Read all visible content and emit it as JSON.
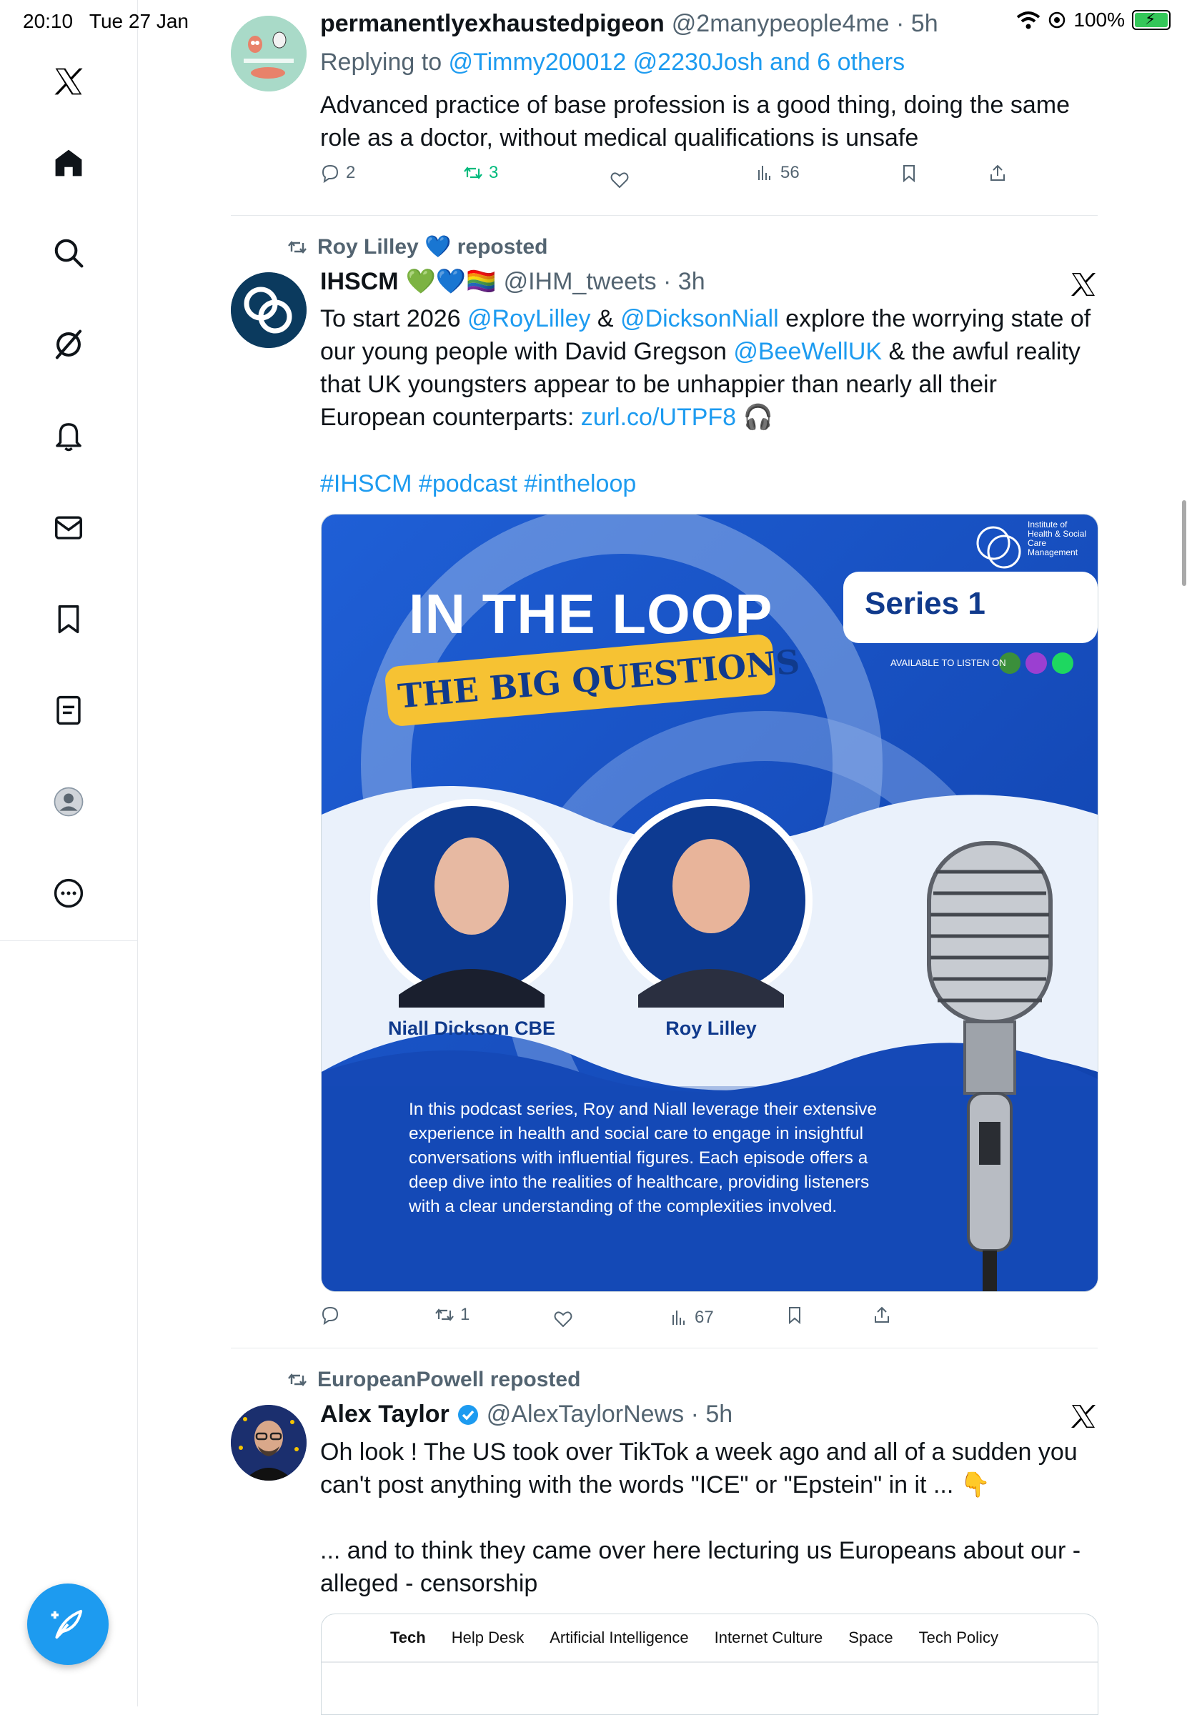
{
  "status_bar": {
    "time_date": "20:10   Tue 27 Jan",
    "battery": "100%"
  },
  "nav": [
    {
      "name": "x-logo-icon"
    },
    {
      "name": "home-icon"
    },
    {
      "name": "search-icon"
    },
    {
      "name": "grok-icon"
    },
    {
      "name": "notifications-icon"
    },
    {
      "name": "messages-icon"
    },
    {
      "name": "bookmarks-icon"
    },
    {
      "name": "lists-icon"
    },
    {
      "name": "profile-icon"
    },
    {
      "name": "more-icon"
    }
  ],
  "tweets": [
    {
      "name": "permanentlyexhaustedpigeon",
      "handle_time": "@2manypeople4me · 5h",
      "reply_prefix": "Replying to ",
      "reply_to": "@Timmy200012 @2230Josh and 6 others",
      "text": "Advanced practice of base profession is a good thing, doing the same role as a doctor, without medical qualifications is unsafe",
      "stats": {
        "replies": "2",
        "reposts": "3",
        "views": "56"
      }
    },
    {
      "reposted_by": "Roy Lilley 💙 reposted",
      "name": "IHSCM",
      "name_emojis": "💚💙🏳️‍🌈",
      "handle_time": "@IHM_tweets · 3h",
      "text_parts": {
        "p1": "To start 2026 ",
        "m1": "@RoyLilley",
        "p2": " & ",
        "m2": "@DicksonNiall",
        "p3": " explore the worrying state of our young people with David Gregson ",
        "m3": "@BeeWellUK",
        "p4": " & the awful reality that UK youngsters appear to be unhappier than nearly all their European counterparts: ",
        "url": "zurl.co/UTPF8",
        "emoji": " 🎧"
      },
      "hashtags": "#IHSCM #podcast #intheloop",
      "stats": {
        "reposts": "1",
        "views": "67"
      },
      "media": {
        "title": "IN THE LOOP",
        "series": "Series 1",
        "banner": "THE BIG QUESTIONS",
        "available": "AVAILABLE TO LISTEN ON",
        "org_logo": "Institute of Health & Social Care Management",
        "person1": "Niall Dickson CBE",
        "person2": "Roy Lilley",
        "blurb_lines": [
          "In this podcast series, Roy and Niall leverage their extensive",
          "experience in health and social care to engage in insightful",
          "conversations with influential figures. Each episode offers a",
          "deep dive into the realities of healthcare, providing listeners",
          "with a clear understanding of the complexities involved."
        ]
      }
    },
    {
      "reposted_by": "EuropeanPowell reposted",
      "name": "Alex Taylor",
      "handle_time": "@AlexTaylorNews · 5h",
      "text1": "Oh look ! The US took over TikTok a week ago and all of a sudden you can't post anything with the words \"ICE\" or \"Epstein\" in it ... 👇",
      "text2": "... and to think they came over here lecturing us Europeans about our - alleged - censorship",
      "card_tabs": [
        "Tech",
        "Help Desk",
        "Artificial Intelligence",
        "Internet Culture",
        "Space",
        "Tech Policy"
      ]
    }
  ],
  "colors": {
    "accent": "#1d9bf0",
    "text": "#0f1419",
    "muted": "#536471",
    "repost_green": "#00ba7c",
    "divider": "#e6e9ec"
  }
}
